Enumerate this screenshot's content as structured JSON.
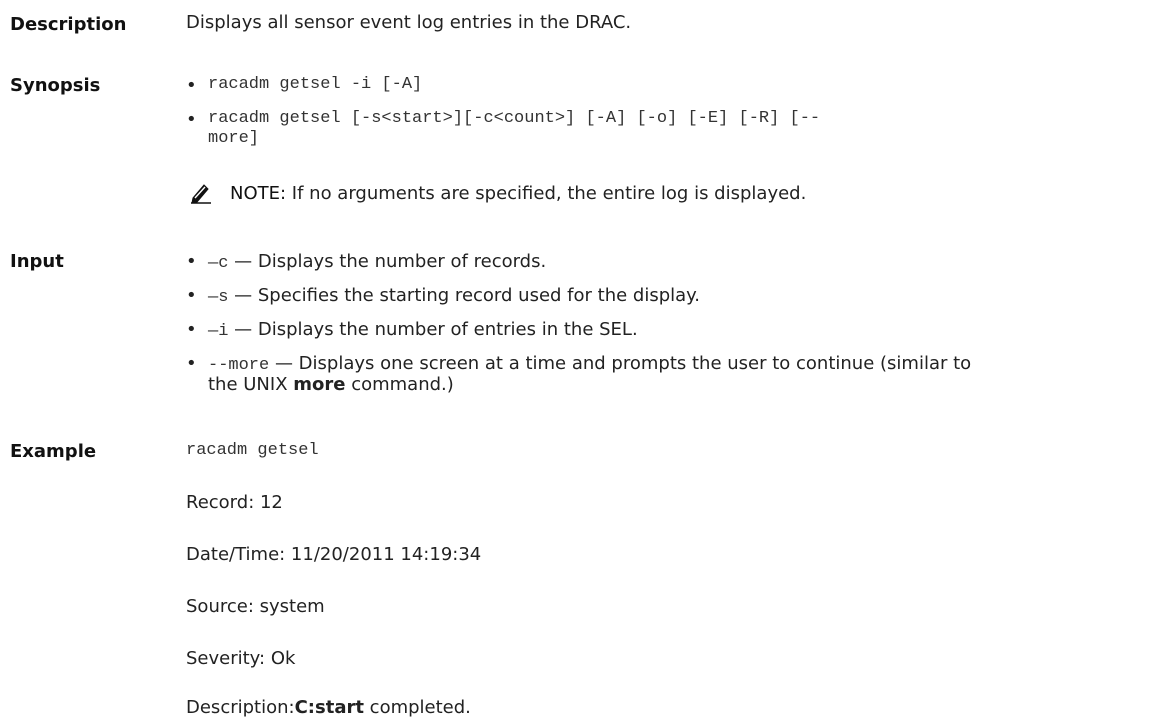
{
  "description": {
    "label": "Description",
    "text": "Displays all sensor event log entries in the DRAC."
  },
  "synopsis": {
    "label": "Synopsis",
    "lines": [
      "racadm getsel -i [-A]",
      "racadm getsel [-s<start>][-c<count>] [-A] [-o] [-E] [-R] [--",
      "more]"
    ],
    "note_label": "NOTE:",
    "note_text": " If no arguments are specified, the entire log is displayed.",
    "note_icon": "pencil-note-icon"
  },
  "input": {
    "label": "Input",
    "items": [
      {
        "code": "—c",
        "sep": " — ",
        "text": "Displays the number of records."
      },
      {
        "code": "—s",
        "sep": " — ",
        "text": "Specifies the starting record used for the display."
      },
      {
        "code": "—i",
        "sep": " — ",
        "text": "Displays the number of entries in the SEL."
      },
      {
        "code": "--more",
        "sep": " — ",
        "text": "Displays one screen at a time and prompts the user to continue (similar to",
        "text2_pre": "the UNIX ",
        "text2_bold": "more",
        "text2_post": " command.)"
      }
    ]
  },
  "example": {
    "label": "Example",
    "command": "racadm getsel",
    "record": "Record: 12",
    "datetime": "Date/Time: 11/20/2011 14:19:34",
    "source": "Source: system",
    "severity": "Severity: Ok",
    "desc_pre": "Description:",
    "desc_bold": "C:start",
    "desc_post": " completed."
  }
}
